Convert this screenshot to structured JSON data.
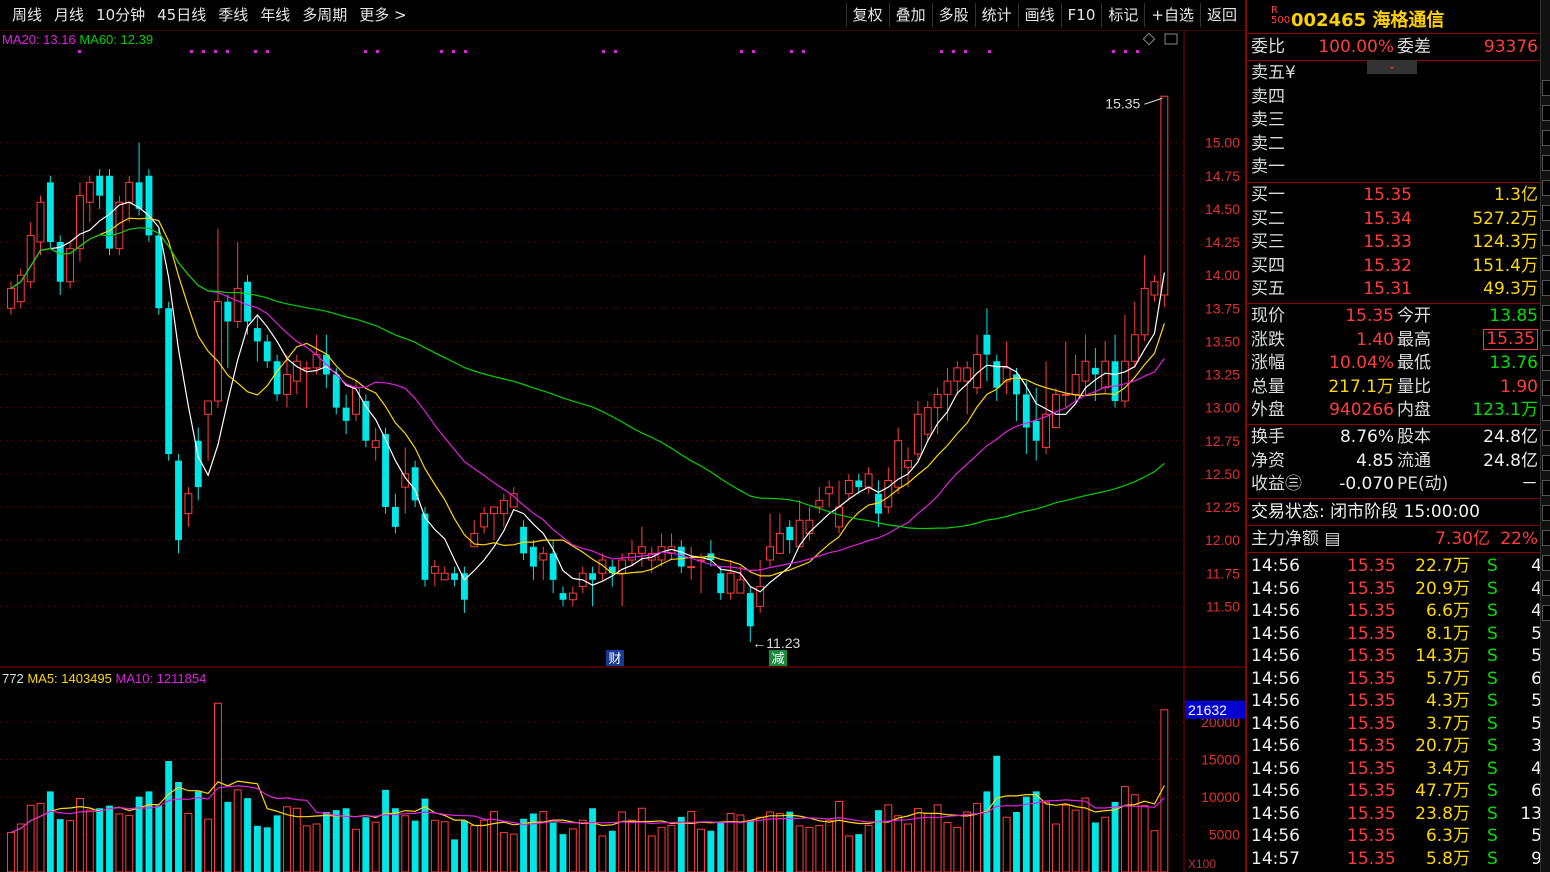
{
  "toolbar": {
    "tabs": [
      "周线",
      "月线",
      "10分钟",
      "45日线",
      "季线",
      "年线",
      "多周期",
      "更多 >"
    ],
    "tools": [
      "复权",
      "叠加",
      "多股",
      "统计",
      "画线",
      "F10",
      "标记",
      "+自选",
      "返回"
    ]
  },
  "chart": {
    "ma_legend": {
      "ma20_label": "MA20: 13.16",
      "ma60_label": "MA60: 12.39"
    },
    "vol_legend": {
      "vol_label": "772",
      "ma5_label": "MA5: 1403495",
      "ma10_label": "MA10: 1211854"
    },
    "price_ticks": [
      "15.00",
      "14.75",
      "14.50",
      "14.25",
      "14.00",
      "13.75",
      "13.50",
      "13.25",
      "13.00",
      "12.75",
      "12.50",
      "12.25",
      "12.00",
      "11.75",
      "11.50"
    ],
    "vol_ticks": [
      "20000",
      "15000",
      "10000",
      "5000"
    ],
    "vol_cursor_value": "21632",
    "vol_unit": "X100",
    "high_label": "15.35",
    "low_label": "11.23",
    "marker_cai": "财",
    "marker_jian": "减",
    "colors": {
      "up": "#ff3c3c",
      "down": "#00e5e5",
      "ma5": "#ffffff",
      "ma10": "#ffd800",
      "ma20": "#e020e0",
      "ma60": "#00d000",
      "grid": "#5a0000"
    }
  },
  "chart_data": {
    "type": "candlestick",
    "ylim": [
      11.2,
      15.6
    ],
    "candles": [
      [
        13.75,
        13.9,
        13.7,
        13.95
      ],
      [
        13.8,
        14.0,
        13.75,
        14.05
      ],
      [
        13.95,
        14.3,
        13.9,
        14.4
      ],
      [
        14.25,
        14.55,
        14.15,
        14.6
      ],
      [
        14.7,
        14.25,
        14.2,
        14.75
      ],
      [
        14.25,
        13.95,
        13.85,
        14.3
      ],
      [
        13.95,
        14.2,
        13.9,
        14.25
      ],
      [
        14.2,
        14.6,
        14.1,
        14.7
      ],
      [
        14.55,
        14.7,
        14.4,
        14.75
      ],
      [
        14.75,
        14.6,
        14.5,
        14.8
      ],
      [
        14.75,
        14.2,
        14.15,
        14.8
      ],
      [
        14.2,
        14.55,
        14.15,
        14.6
      ],
      [
        14.55,
        14.7,
        14.4,
        14.75
      ],
      [
        14.7,
        14.5,
        14.45,
        15.0
      ],
      [
        14.75,
        14.3,
        14.25,
        14.8
      ],
      [
        14.3,
        13.75,
        13.7,
        14.35
      ],
      [
        13.75,
        12.65,
        12.6,
        13.8
      ],
      [
        12.6,
        12.0,
        11.9,
        12.65
      ],
      [
        12.2,
        12.35,
        12.1,
        12.4
      ],
      [
        12.75,
        12.4,
        12.3,
        12.85
      ],
      [
        12.95,
        13.05,
        12.6,
        13.05
      ],
      [
        13.05,
        13.8,
        13.0,
        14.35
      ],
      [
        13.8,
        13.65,
        13.3,
        13.85
      ],
      [
        13.65,
        13.9,
        13.6,
        14.25
      ],
      [
        13.95,
        13.65,
        13.55,
        14.0
      ],
      [
        13.6,
        13.5,
        13.35,
        13.7
      ],
      [
        13.5,
        13.35,
        13.3,
        13.55
      ],
      [
        13.35,
        13.1,
        13.05,
        13.4
      ],
      [
        13.1,
        13.25,
        13.0,
        13.4
      ],
      [
        13.2,
        13.35,
        13.1,
        13.4
      ],
      [
        13.3,
        13.3,
        13.0,
        13.35
      ],
      [
        13.3,
        13.4,
        13.25,
        13.55
      ],
      [
        13.4,
        13.25,
        13.15,
        13.55
      ],
      [
        13.25,
        13.0,
        12.95,
        13.3
      ],
      [
        13.0,
        12.9,
        12.8,
        13.1
      ],
      [
        12.95,
        13.15,
        12.9,
        13.2
      ],
      [
        13.05,
        12.75,
        12.7,
        13.1
      ],
      [
        12.7,
        12.75,
        12.6,
        12.85
      ],
      [
        12.8,
        12.25,
        12.2,
        12.85
      ],
      [
        12.25,
        12.1,
        12.05,
        12.35
      ],
      [
        12.4,
        12.5,
        12.2,
        12.7
      ],
      [
        12.55,
        12.3,
        12.25,
        12.6
      ],
      [
        12.2,
        11.7,
        11.65,
        12.25
      ],
      [
        11.75,
        11.8,
        11.65,
        11.85
      ],
      [
        11.7,
        11.75,
        11.7,
        11.8
      ],
      [
        11.75,
        11.7,
        11.65,
        11.8
      ],
      [
        11.75,
        11.55,
        11.45,
        11.8
      ],
      [
        11.95,
        12.05,
        11.95,
        12.15
      ],
      [
        12.1,
        12.2,
        12.05,
        12.25
      ],
      [
        12.2,
        12.25,
        12.0,
        12.25
      ],
      [
        12.2,
        12.3,
        12.1,
        12.35
      ],
      [
        12.25,
        12.35,
        12.25,
        12.4
      ],
      [
        12.1,
        11.9,
        11.85,
        12.15
      ],
      [
        11.95,
        11.8,
        11.7,
        12.0
      ],
      [
        11.85,
        11.9,
        11.7,
        11.95
      ],
      [
        11.9,
        11.7,
        11.6,
        12.0
      ],
      [
        11.6,
        11.55,
        11.5,
        11.65
      ],
      [
        11.55,
        11.6,
        11.5,
        11.65
      ],
      [
        11.65,
        11.75,
        11.6,
        11.8
      ],
      [
        11.75,
        11.7,
        11.5,
        11.8
      ],
      [
        11.75,
        11.85,
        11.7,
        11.9
      ],
      [
        11.8,
        11.75,
        11.65,
        11.85
      ],
      [
        11.75,
        11.85,
        11.5,
        11.9
      ],
      [
        11.85,
        11.9,
        11.8,
        12.0
      ],
      [
        11.9,
        11.95,
        11.8,
        12.1
      ],
      [
        11.85,
        11.9,
        11.75,
        11.95
      ],
      [
        11.85,
        11.95,
        11.8,
        12.05
      ],
      [
        11.9,
        11.95,
        11.85,
        12.05
      ],
      [
        11.95,
        11.8,
        11.75,
        12.0
      ],
      [
        11.8,
        11.8,
        11.7,
        11.95
      ],
      [
        11.85,
        11.85,
        11.6,
        11.9
      ],
      [
        11.9,
        11.85,
        11.8,
        12.0
      ],
      [
        11.75,
        11.6,
        11.55,
        11.8
      ],
      [
        11.6,
        11.75,
        11.55,
        11.85
      ],
      [
        11.6,
        11.7,
        11.6,
        11.8
      ],
      [
        11.6,
        11.35,
        11.23,
        11.65
      ],
      [
        11.5,
        11.65,
        11.45,
        11.85
      ],
      [
        11.85,
        11.95,
        11.8,
        12.2
      ],
      [
        11.9,
        12.05,
        11.9,
        12.2
      ],
      [
        12.1,
        12.0,
        11.9,
        12.15
      ],
      [
        11.95,
        12.15,
        11.95,
        12.3
      ],
      [
        12.05,
        12.15,
        12.0,
        12.25
      ],
      [
        12.25,
        12.3,
        12.2,
        12.4
      ],
      [
        12.35,
        12.4,
        12.25,
        12.45
      ],
      [
        12.1,
        12.25,
        12.05,
        12.45
      ],
      [
        12.35,
        12.45,
        12.3,
        12.5
      ],
      [
        12.45,
        12.4,
        12.35,
        12.5
      ],
      [
        12.4,
        12.5,
        12.35,
        12.55
      ],
      [
        12.35,
        12.2,
        12.1,
        12.45
      ],
      [
        12.25,
        12.45,
        12.2,
        12.55
      ],
      [
        12.4,
        12.75,
        12.35,
        12.85
      ],
      [
        12.55,
        12.6,
        12.4,
        12.7
      ],
      [
        12.65,
        12.95,
        12.6,
        13.05
      ],
      [
        12.8,
        13.0,
        12.75,
        13.05
      ],
      [
        13.0,
        13.1,
        12.8,
        13.15
      ],
      [
        13.1,
        13.2,
        12.9,
        13.3
      ],
      [
        13.2,
        13.3,
        13.1,
        13.35
      ],
      [
        13.2,
        13.3,
        12.95,
        13.35
      ],
      [
        13.15,
        13.4,
        13.1,
        13.55
      ],
      [
        13.55,
        13.4,
        13.2,
        13.75
      ],
      [
        13.35,
        13.15,
        13.05,
        13.4
      ],
      [
        13.2,
        13.3,
        13.1,
        13.5
      ],
      [
        13.25,
        13.1,
        12.9,
        13.3
      ],
      [
        13.1,
        12.85,
        12.65,
        13.2
      ],
      [
        12.9,
        12.75,
        12.6,
        13.15
      ],
      [
        12.7,
        12.95,
        12.65,
        13.35
      ],
      [
        12.85,
        13.1,
        12.85,
        13.15
      ],
      [
        13.1,
        13.1,
        13.0,
        13.5
      ],
      [
        13.1,
        13.25,
        13.05,
        13.4
      ],
      [
        13.2,
        13.35,
        13.1,
        13.55
      ],
      [
        13.3,
        13.25,
        13.05,
        13.45
      ],
      [
        13.15,
        13.35,
        13.1,
        13.5
      ],
      [
        13.35,
        13.05,
        13.0,
        13.55
      ],
      [
        13.05,
        13.35,
        13.0,
        13.7
      ],
      [
        13.35,
        13.55,
        13.3,
        13.8
      ],
      [
        13.55,
        13.9,
        13.5,
        14.15
      ],
      [
        13.85,
        13.95,
        13.8,
        14.0
      ],
      [
        13.85,
        15.35,
        13.76,
        15.35
      ]
    ],
    "volume_unit": "X100",
    "volume_ylim": [
      0,
      24000
    ],
    "volume_series_note": "per-candle volume in hundreds of shares"
  },
  "quote": {
    "badge_r": "R",
    "badge_500": "500",
    "code": "002465",
    "name": "海格通信",
    "weibi_label": "委比",
    "weibi_val": "100.00%",
    "weicha_label": "委差",
    "weicha_val": "93376",
    "sell": [
      {
        "label": "卖五",
        "price": "",
        "vol": "",
        "extra": "¥"
      },
      {
        "label": "卖四",
        "price": "",
        "vol": ""
      },
      {
        "label": "卖三",
        "price": "",
        "vol": ""
      },
      {
        "label": "卖二",
        "price": "",
        "vol": ""
      },
      {
        "label": "卖一",
        "price": "",
        "vol": ""
      }
    ],
    "buy": [
      {
        "label": "买一",
        "price": "15.35",
        "vol": "1.3亿"
      },
      {
        "label": "买二",
        "price": "15.34",
        "vol": "527.2万"
      },
      {
        "label": "买三",
        "price": "15.33",
        "vol": "124.3万"
      },
      {
        "label": "买四",
        "price": "15.32",
        "vol": "151.4万"
      },
      {
        "label": "买五",
        "price": "15.31",
        "vol": "49.3万"
      }
    ],
    "stats": [
      {
        "l1": "现价",
        "v1": "15.35",
        "l2": "今开",
        "v2": "13.85",
        "c1": "red",
        "c2": "green"
      },
      {
        "l1": "涨跌",
        "v1": "1.40",
        "l2": "最高",
        "v2": "15.35",
        "c1": "red",
        "c2": "red"
      },
      {
        "l1": "涨幅",
        "v1": "10.04%",
        "l2": "最低",
        "v2": "13.76",
        "c1": "red",
        "c2": "green"
      },
      {
        "l1": "总量",
        "v1": "217.1万",
        "l2": "量比",
        "v2": "1.90",
        "c1": "yellow",
        "c2": "red"
      },
      {
        "l1": "外盘",
        "v1": "940266",
        "l2": "内盘",
        "v2": "123.1万",
        "c1": "red",
        "c2": "green"
      }
    ],
    "stats2": [
      {
        "l1": "换手",
        "v1": "8.76%",
        "l2": "股本",
        "v2": "24.8亿"
      },
      {
        "l1": "净资",
        "v1": "4.85",
        "l2": "流通",
        "v2": "24.8亿"
      },
      {
        "l1": "收益㊂",
        "v1": "-0.070",
        "l2": "PE(动)",
        "v2": "－"
      }
    ],
    "trade_status": "交易状态: 闭市阶段 15:00:00",
    "main_net_label": "主力净额",
    "main_net_val": "7.30亿",
    "main_net_pct": "22%",
    "ticks": [
      {
        "t": "14:56",
        "p": "15.35",
        "v": "22.7万",
        "d": "S",
        "n": "4"
      },
      {
        "t": "14:56",
        "p": "15.35",
        "v": "20.9万",
        "d": "S",
        "n": "4"
      },
      {
        "t": "14:56",
        "p": "15.35",
        "v": "6.6万",
        "d": "S",
        "n": "4"
      },
      {
        "t": "14:56",
        "p": "15.35",
        "v": "8.1万",
        "d": "S",
        "n": "5"
      },
      {
        "t": "14:56",
        "p": "15.35",
        "v": "14.3万",
        "d": "S",
        "n": "5"
      },
      {
        "t": "14:56",
        "p": "15.35",
        "v": "5.7万",
        "d": "S",
        "n": "6"
      },
      {
        "t": "14:56",
        "p": "15.35",
        "v": "4.3万",
        "d": "S",
        "n": "5"
      },
      {
        "t": "14:56",
        "p": "15.35",
        "v": "3.7万",
        "d": "S",
        "n": "5"
      },
      {
        "t": "14:56",
        "p": "15.35",
        "v": "20.7万",
        "d": "S",
        "n": "3"
      },
      {
        "t": "14:56",
        "p": "15.35",
        "v": "3.4万",
        "d": "S",
        "n": "4"
      },
      {
        "t": "14:56",
        "p": "15.35",
        "v": "47.7万",
        "d": "S",
        "n": "6"
      },
      {
        "t": "14:56",
        "p": "15.35",
        "v": "23.8万",
        "d": "S",
        "n": "13"
      },
      {
        "t": "14:56",
        "p": "15.35",
        "v": "6.3万",
        "d": "S",
        "n": "5"
      },
      {
        "t": "14:57",
        "p": "15.35",
        "v": "5.8万",
        "d": "S",
        "n": "9"
      }
    ]
  }
}
